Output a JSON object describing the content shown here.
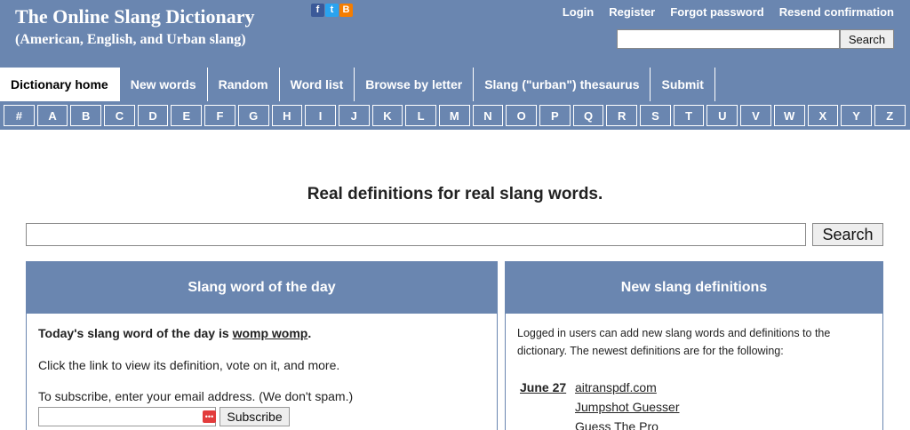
{
  "header": {
    "title": "The Online Slang Dictionary",
    "subtitle": "(American, English, and Urban slang)",
    "social_icons": [
      "facebook-icon",
      "twitter-icon",
      "blogger-icon"
    ],
    "top_links": [
      "Login",
      "Register",
      "Forgot password",
      "Resend confirmation"
    ],
    "search": {
      "value": "",
      "button": "Search"
    }
  },
  "tabs": [
    {
      "label": "Dictionary home",
      "active": true
    },
    {
      "label": "New words",
      "active": false
    },
    {
      "label": "Random",
      "active": false
    },
    {
      "label": "Word list",
      "active": false
    },
    {
      "label": "Browse by letter",
      "active": false
    },
    {
      "label": "Slang (\"urban\") thesaurus",
      "active": false
    },
    {
      "label": "Submit",
      "active": false
    }
  ],
  "letters": [
    "#",
    "A",
    "B",
    "C",
    "D",
    "E",
    "F",
    "G",
    "H",
    "I",
    "J",
    "K",
    "L",
    "M",
    "N",
    "O",
    "P",
    "Q",
    "R",
    "S",
    "T",
    "U",
    "V",
    "W",
    "X",
    "Y",
    "Z"
  ],
  "main": {
    "tagline": "Real definitions for real slang words.",
    "search": {
      "value": "",
      "button": "Search"
    }
  },
  "word_of_day": {
    "heading": "Slang word of the day",
    "intro": "Today's slang word of the day is ",
    "word": "womp womp",
    "intro_end": ".",
    "text": "Click the link to view its definition, vote on it, and more.",
    "subscribe_text": "To subscribe, enter your email address. (We don't spam.)",
    "email_value": "",
    "subscribe_button": "Subscribe"
  },
  "new_definitions": {
    "heading": "New slang definitions",
    "text": "Logged in users can add new slang words and definitions to the dictionary. The newest definitions are for the following:",
    "date": "June 27",
    "items": [
      "aitranspdf.com",
      "Jumpshot Guesser",
      "Guess The Pro"
    ]
  },
  "colors": {
    "accent": "#6a86b0"
  }
}
